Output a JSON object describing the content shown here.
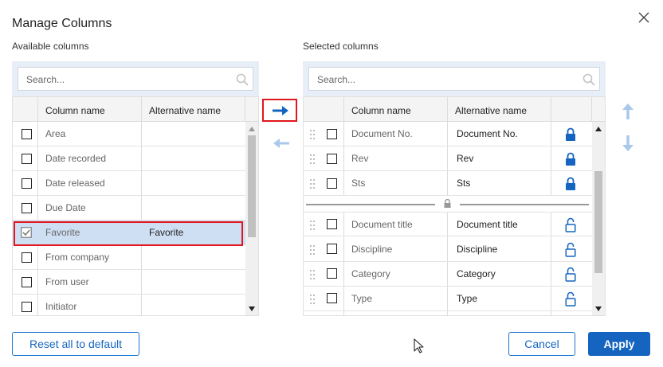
{
  "dialog": {
    "title": "Manage Columns"
  },
  "available": {
    "label": "Available columns",
    "search_placeholder": "Search...",
    "columns": [
      "Column name",
      "Alternative name"
    ],
    "rows": [
      {
        "name": "Area",
        "alt": "",
        "checked": false
      },
      {
        "name": "Date recorded",
        "alt": "",
        "checked": false
      },
      {
        "name": "Date released",
        "alt": "",
        "checked": false
      },
      {
        "name": "Due Date",
        "alt": "",
        "checked": false
      },
      {
        "name": "Favorite",
        "alt": "Favorite",
        "checked": true,
        "selected": true
      },
      {
        "name": "From company",
        "alt": "",
        "checked": false
      },
      {
        "name": "From user",
        "alt": "",
        "checked": false
      },
      {
        "name": "Initiator",
        "alt": "",
        "checked": false
      }
    ]
  },
  "selected": {
    "label": "Selected columns",
    "search_placeholder": "Search...",
    "columns": [
      "Column name",
      "Alternative name"
    ],
    "locked_rows": [
      {
        "name": "Document No.",
        "alt": "Document No.",
        "lock": "locked"
      },
      {
        "name": "Rev",
        "alt": "Rev",
        "lock": "locked"
      },
      {
        "name": "Sts",
        "alt": "Sts",
        "lock": "locked"
      }
    ],
    "rows": [
      {
        "name": "Document title",
        "alt": "Document title",
        "lock": "unlocked"
      },
      {
        "name": "Discipline",
        "alt": "Discipline",
        "lock": "unlocked"
      },
      {
        "name": "Category",
        "alt": "Category",
        "lock": "unlocked"
      },
      {
        "name": "Type",
        "alt": "Type",
        "lock": "unlocked"
      }
    ]
  },
  "buttons": {
    "reset": "Reset all to default",
    "cancel": "Cancel",
    "apply": "Apply"
  },
  "icons": {
    "move_right": "arrow-right-icon",
    "move_left": "arrow-left-icon",
    "move_up": "arrow-up-icon",
    "move_down": "arrow-down-icon",
    "close": "close-icon",
    "search": "search-icon",
    "lock": "lock-icon",
    "unlock": "unlock-icon",
    "drag": "drag-handle-icon"
  },
  "colors": {
    "accent": "#1565c0",
    "highlight": "#e2161d",
    "panel": "#e7eef8",
    "selected_row": "#cfdff3",
    "disabled_arrow": "#a9c8ec"
  }
}
